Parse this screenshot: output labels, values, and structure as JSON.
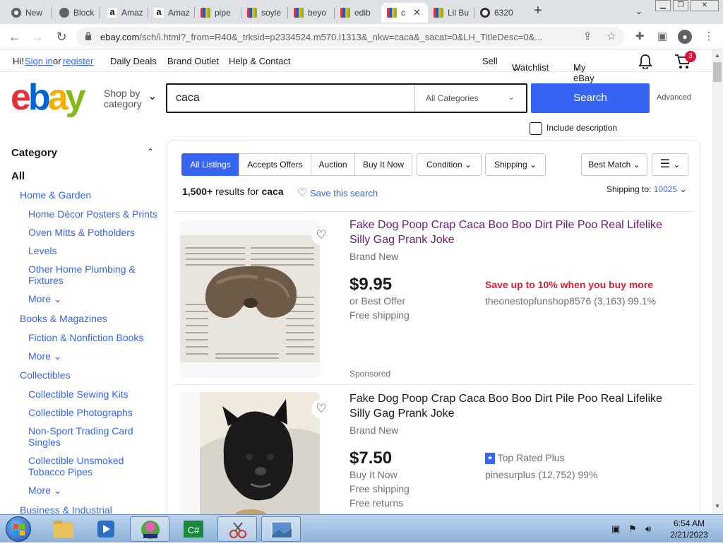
{
  "browser": {
    "tabs": [
      {
        "label": "New",
        "icon": "chrome-icon"
      },
      {
        "label": "Block",
        "icon": "globe-icon"
      },
      {
        "label": "Amaz",
        "icon": "amazon-icon"
      },
      {
        "label": "Amaz",
        "icon": "amazon-icon"
      },
      {
        "label": "pipe",
        "icon": "ebay-bag-icon"
      },
      {
        "label": "soyle",
        "icon": "ebay-bag-icon"
      },
      {
        "label": "beyo",
        "icon": "ebay-bag-icon"
      },
      {
        "label": "edib",
        "icon": "ebay-bag-icon"
      },
      {
        "label": "c",
        "icon": "ebay-bag-icon"
      },
      {
        "label": "Lil Bu",
        "icon": "ebay-bag-icon"
      },
      {
        "label": "6320",
        "icon": "circle-icon"
      }
    ],
    "new_tab": "+",
    "url_host": "ebay.com",
    "url_rest": "/sch/i.html?_from=R40&_trksid=p2334524.m570.l1313&_nkw=caca&_sacat=0&LH_TitleDesc=0&..."
  },
  "header": {
    "greeting": "Hi!",
    "sign_in": "Sign in",
    "or": "or",
    "register": "register",
    "daily_deals": "Daily Deals",
    "brand_outlet": "Brand Outlet",
    "help": "Help & Contact",
    "sell": "Sell",
    "watchlist": "Watchlist",
    "my_ebay": "My eBay",
    "cart_count": "3"
  },
  "search": {
    "shop_by": "Shop by",
    "category": "category",
    "query": "caca",
    "category_select": "All Categories",
    "button": "Search",
    "advanced": "Advanced",
    "include_description": "Include description"
  },
  "sidebar": {
    "heading": "Category",
    "all": "All",
    "items": [
      {
        "label": "Home & Garden",
        "level": 1
      },
      {
        "label": "Home Décor Posters & Prints",
        "level": 2
      },
      {
        "label": "Oven Mitts & Potholders",
        "level": 2
      },
      {
        "label": "Levels",
        "level": 2
      },
      {
        "label": "Other Home Plumbing &",
        "level": 2
      },
      {
        "label": "Fixtures",
        "level": 2
      },
      {
        "label": "More",
        "level": 2
      },
      {
        "label": "Books & Magazines",
        "level": 1
      },
      {
        "label": "Fiction & Nonfiction Books",
        "level": 2
      },
      {
        "label": "More",
        "level": 2
      },
      {
        "label": "Collectibles",
        "level": 1
      },
      {
        "label": "Collectible Sewing Kits",
        "level": 2
      },
      {
        "label": "Collectible Photographs",
        "level": 2
      },
      {
        "label": "Non-Sport Trading Card",
        "level": 2
      },
      {
        "label": "Singles",
        "level": 2
      },
      {
        "label": "Collectible Unsmoked",
        "level": 2
      },
      {
        "label": "Tobacco Pipes",
        "level": 2
      },
      {
        "label": "More",
        "level": 2
      },
      {
        "label": "Business & Industrial",
        "level": 1
      }
    ]
  },
  "filters": {
    "pills": [
      "All Listings",
      "Accepts Offers",
      "Auction",
      "Buy It Now",
      "Condition",
      "Shipping"
    ],
    "sort": "Best Match",
    "view": "list-view"
  },
  "results": {
    "count": "1,500+",
    "results_for": "results for",
    "query": "caca",
    "save_search": "Save this search",
    "shipping_to_label": "Shipping to:",
    "zip": "10025",
    "items": [
      {
        "title_line1": "Fake Dog Poop Crap Caca Boo Boo Dirt Pile Poo Real Lifelike",
        "title_line2": "Silly Gag Prank Joke",
        "condition": "Brand New",
        "price": "$9.95",
        "buy_format": "or Best Offer",
        "shipping": "Free shipping",
        "promo": "Save up to 10% when you buy more",
        "seller": "theonestopfunshop8576 (3,163) 99.1%",
        "sponsored": "Sponsored"
      },
      {
        "title_line1": "Fake Dog Poop Crap Caca Boo Boo Dirt Pile Poo Real Lifelike",
        "title_line2": "Silly Gag Prank Joke",
        "condition": "Brand New",
        "price": "$7.50",
        "buy_format": "Buy It Now",
        "shipping": "Free shipping",
        "returns": "Free returns",
        "badge": "Top Rated Plus",
        "seller": "pinesurplus (12,752) 99%"
      }
    ]
  },
  "taskbar": {
    "time": "6:54 AM",
    "date": "2/21/2023"
  },
  "colors": {
    "ebay_blue": "#3665f3",
    "promo_red": "#dd1e31",
    "title_purple": "#6a1b6f",
    "logo_e": "#e53238",
    "logo_b": "#0064d2",
    "logo_a": "#f5af02",
    "logo_y": "#86b817"
  }
}
